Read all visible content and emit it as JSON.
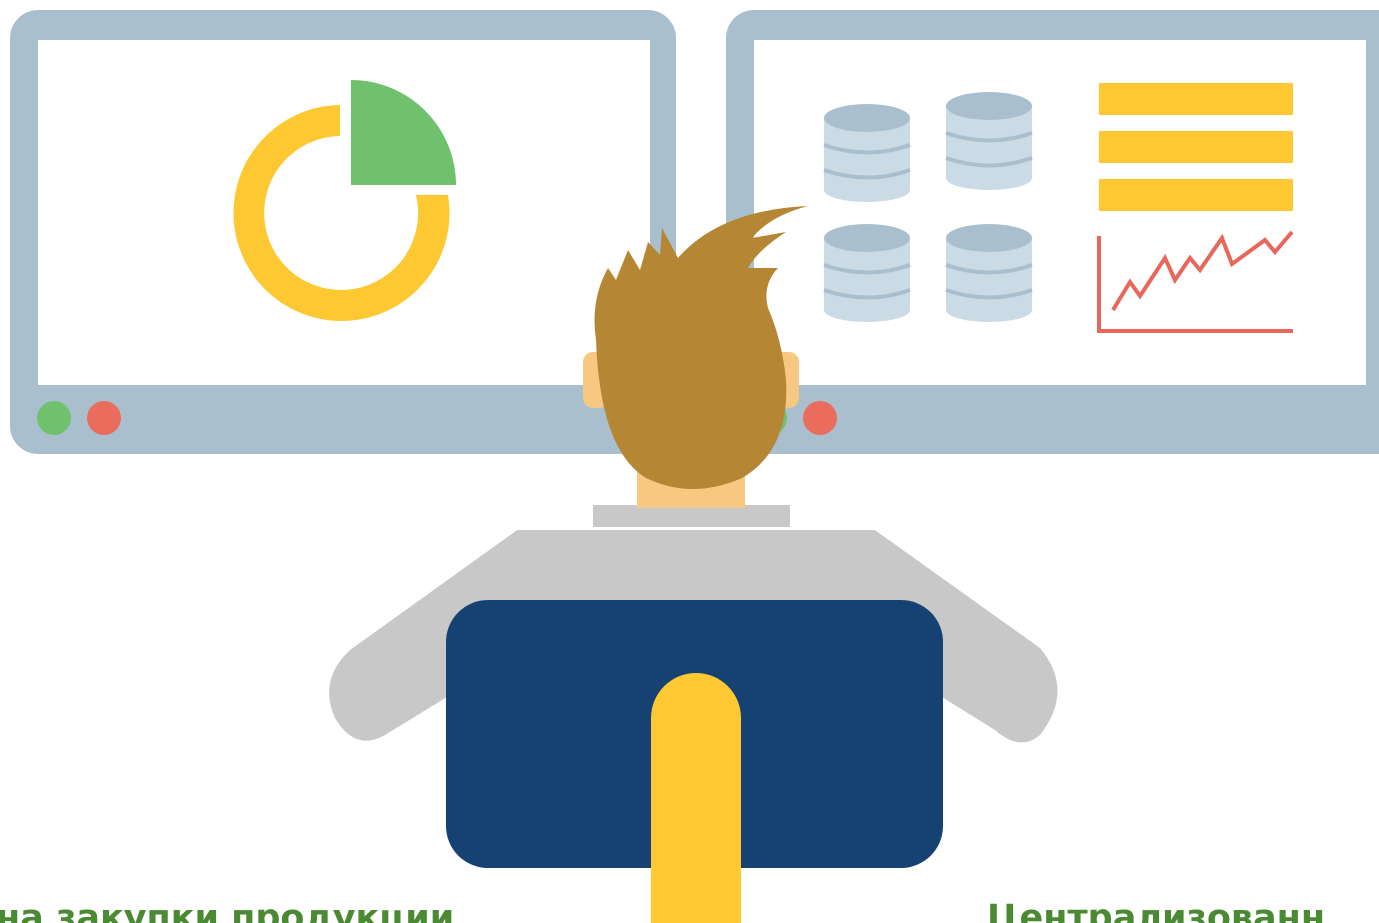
{
  "captions": {
    "left": "на закупки продукции",
    "right": "Централизованн"
  },
  "colors": {
    "monitor_frame": "#a9bfce",
    "screen": "#ffffff",
    "yellow": "#fec832",
    "green": "#6fc16e",
    "red": "#ea6c5d",
    "database_light": "#cbdbe6",
    "database_dark": "#a9bfce",
    "chart_line": "#e8675a",
    "hair": "#b58735",
    "skin": "#f7c881",
    "shirt": "#c8c8c8",
    "chair": "#164273",
    "caption_text": "#4a8a32"
  }
}
